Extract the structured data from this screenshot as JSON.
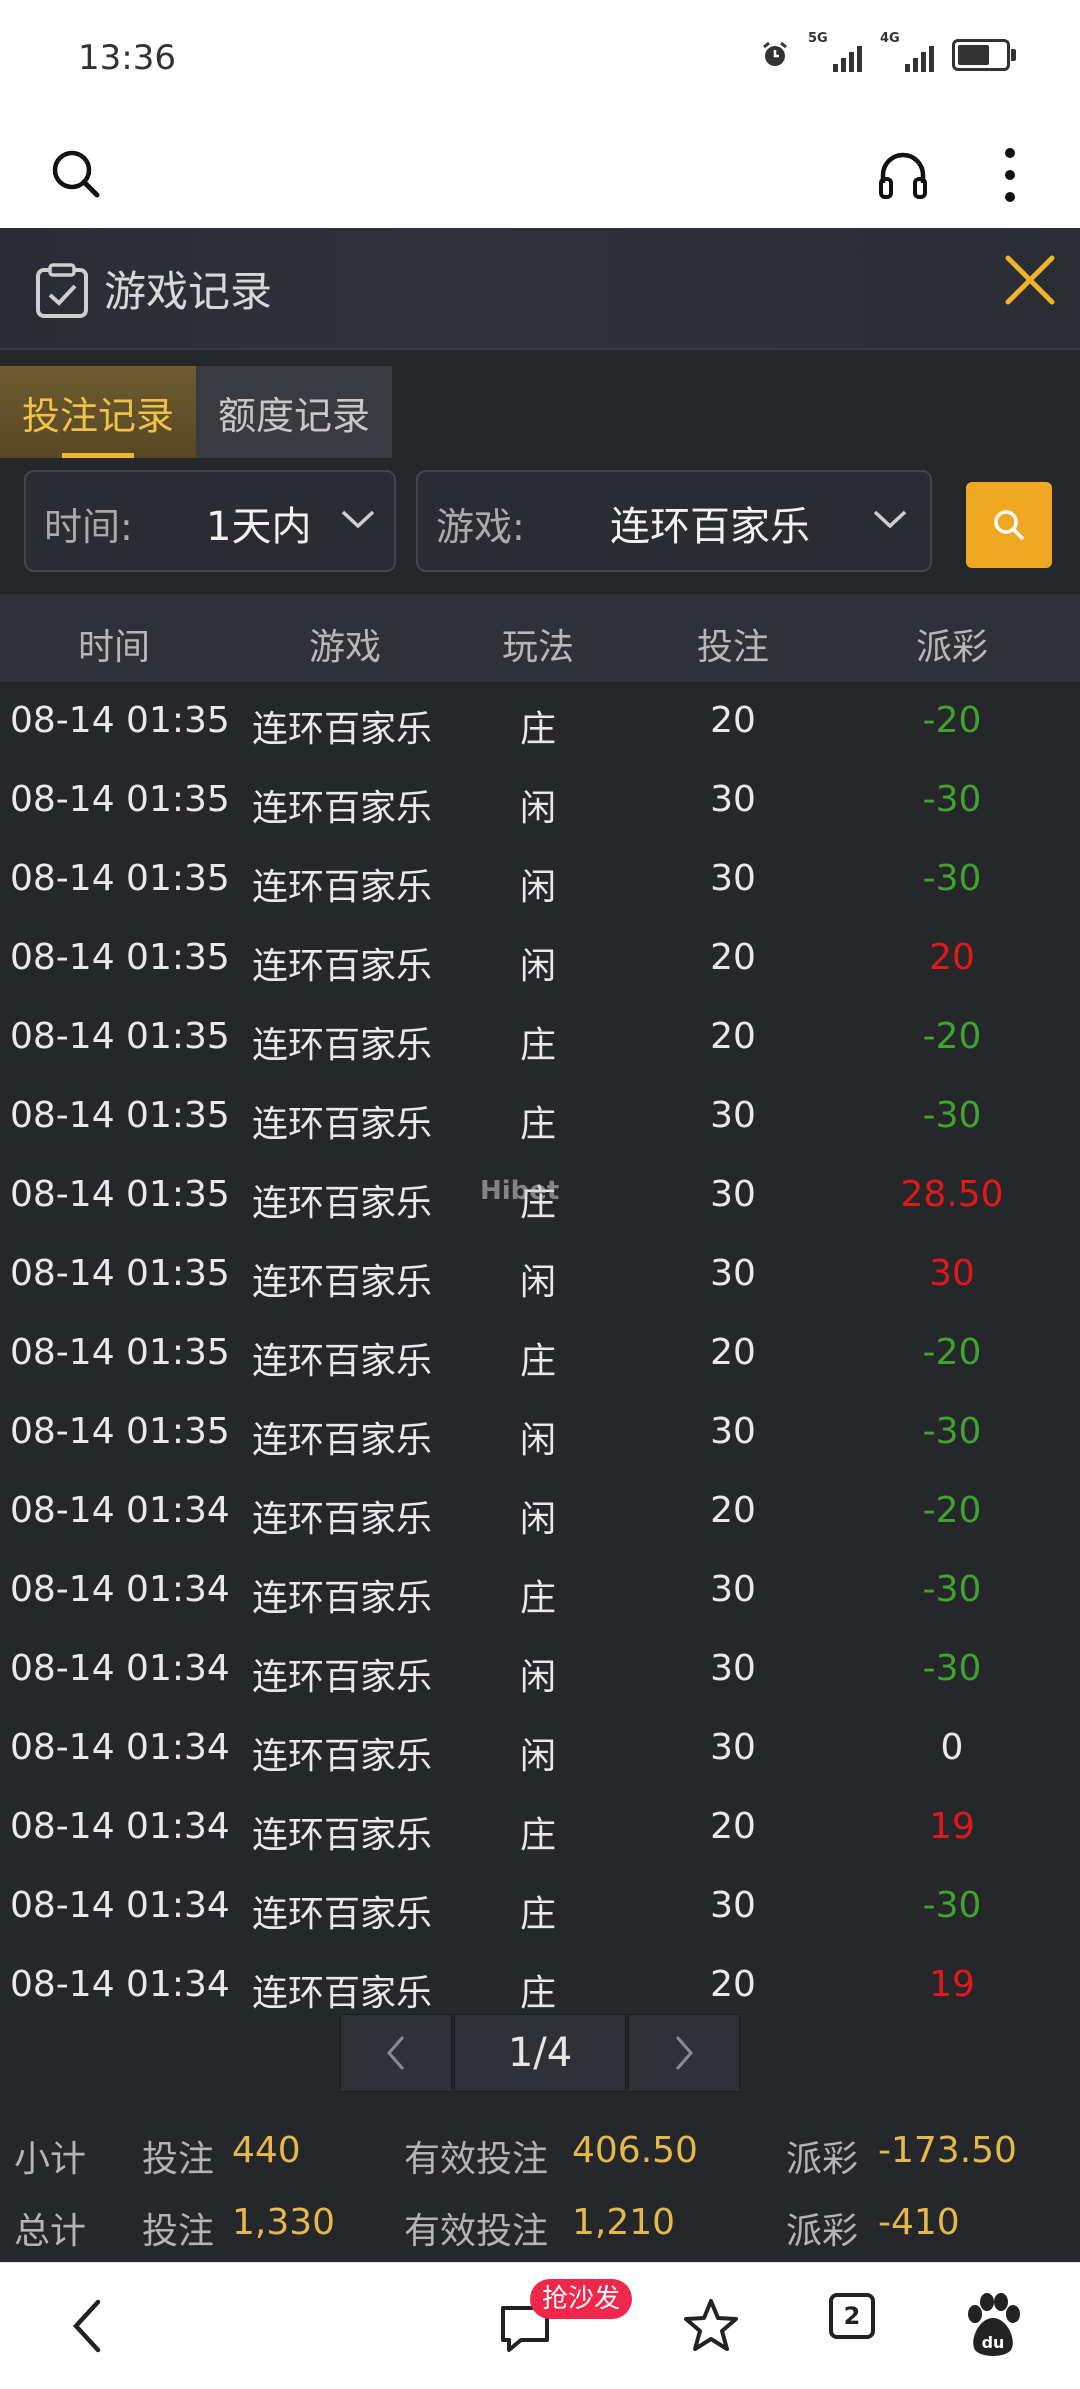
{
  "status_bar": {
    "time": "13:36",
    "signal1": "5G",
    "signal2": "4G",
    "battery_level": 0.7
  },
  "topbar": {
    "search_icon": "search-icon",
    "headphone_icon": "headphones-icon",
    "more_icon": "more-vertical-icon"
  },
  "panel": {
    "title": "游戏记录",
    "tabs": [
      {
        "label": "投注记录",
        "active": true
      },
      {
        "label": "额度记录",
        "active": false
      }
    ],
    "filters": {
      "time_label": "时间:",
      "time_value": "1天内",
      "game_label": "游戏:",
      "game_value": "连环百家乐"
    }
  },
  "table": {
    "headers": [
      "时间",
      "游戏",
      "玩法",
      "投注",
      "派彩"
    ],
    "rows": [
      [
        "08-14 01:35",
        "连环百家乐",
        "庄",
        "20",
        "-20"
      ],
      [
        "08-14 01:35",
        "连环百家乐",
        "闲",
        "30",
        "-30"
      ],
      [
        "08-14 01:35",
        "连环百家乐",
        "闲",
        "30",
        "-30"
      ],
      [
        "08-14 01:35",
        "连环百家乐",
        "闲",
        "20",
        "20"
      ],
      [
        "08-14 01:35",
        "连环百家乐",
        "庄",
        "20",
        "-20"
      ],
      [
        "08-14 01:35",
        "连环百家乐",
        "庄",
        "30",
        "-30"
      ],
      [
        "08-14 01:35",
        "连环百家乐",
        "庄",
        "30",
        "28.50"
      ],
      [
        "08-14 01:35",
        "连环百家乐",
        "闲",
        "30",
        "30"
      ],
      [
        "08-14 01:35",
        "连环百家乐",
        "庄",
        "20",
        "-20"
      ],
      [
        "08-14 01:35",
        "连环百家乐",
        "闲",
        "30",
        "-30"
      ],
      [
        "08-14 01:34",
        "连环百家乐",
        "闲",
        "20",
        "-20"
      ],
      [
        "08-14 01:34",
        "连环百家乐",
        "庄",
        "30",
        "-30"
      ],
      [
        "08-14 01:34",
        "连环百家乐",
        "闲",
        "30",
        "-30"
      ],
      [
        "08-14 01:34",
        "连环百家乐",
        "闲",
        "30",
        "0"
      ],
      [
        "08-14 01:34",
        "连环百家乐",
        "庄",
        "20",
        "19"
      ],
      [
        "08-14 01:34",
        "连环百家乐",
        "庄",
        "30",
        "-30"
      ],
      [
        "08-14 01:34",
        "连环百家乐",
        "庄",
        "20",
        "19"
      ]
    ]
  },
  "watermark": "Hibet",
  "pagination": {
    "page": "1/4"
  },
  "summary": {
    "subtotal": {
      "label": "小计",
      "bet_label": "投注",
      "bet": "440",
      "valid_label": "有效投注",
      "valid": "406.50",
      "payout_label": "派彩",
      "payout": "-173.50"
    },
    "total": {
      "label": "总计",
      "bet_label": "投注",
      "bet": "1,330",
      "valid_label": "有效投注",
      "valid": "1,210",
      "payout_label": "派彩",
      "payout": "-410"
    }
  },
  "bottom_nav": {
    "comment_badge": "抢沙发",
    "tab_count": "2"
  },
  "colors": {
    "accent": "#f0a722",
    "positive": "#e01818",
    "negative": "#3fa32e",
    "background": "#26272b"
  }
}
